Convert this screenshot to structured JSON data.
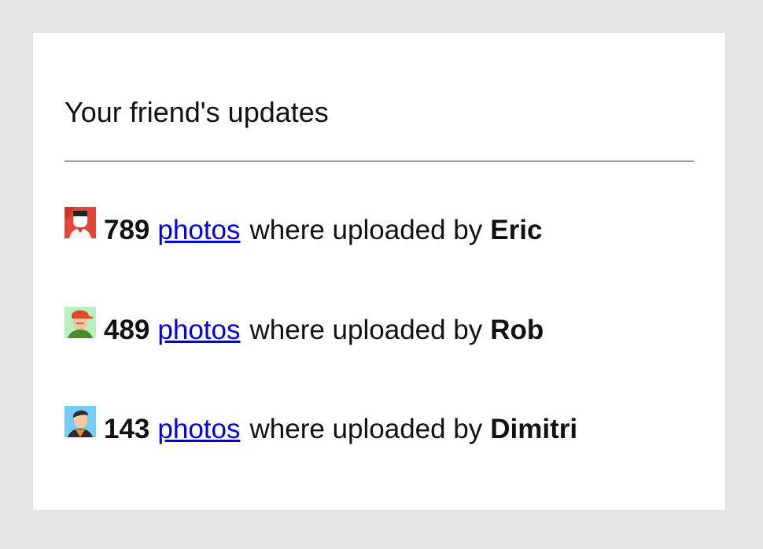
{
  "header": {
    "title": "Your friend's updates"
  },
  "updates": [
    {
      "avatar_icon": "user-avatar-icon",
      "avatar_bg": "#e0463a",
      "count": "789",
      "link_label": "photos",
      "text": "where uploaded by",
      "user": "Eric"
    },
    {
      "avatar_icon": "user-avatar-icon",
      "avatar_bg": "#b9f0c0",
      "count": "489",
      "link_label": "photos",
      "text": "where uploaded by",
      "user": "Rob"
    },
    {
      "avatar_icon": "user-avatar-icon",
      "avatar_bg": "#74cdf5",
      "count": "143",
      "link_label": "photos",
      "text": "where uploaded by",
      "user": "Dimitri"
    }
  ],
  "colors": {
    "background": "#e4e4e4",
    "card": "#ffffff",
    "link": "#0000ee",
    "divider": "#9e9e9e"
  }
}
